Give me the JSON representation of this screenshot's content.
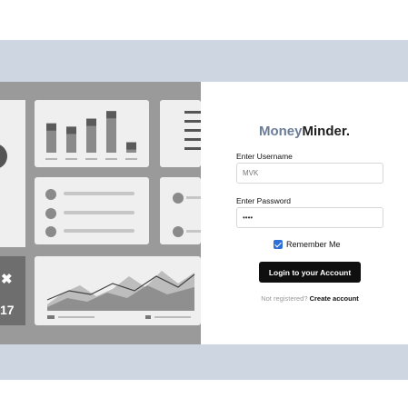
{
  "brand": {
    "part1": "Money",
    "part2": "Minder."
  },
  "username": {
    "label": "Enter Username",
    "value": "MVK"
  },
  "password": {
    "label": "Enter Password",
    "value": "••••"
  },
  "remember": {
    "label": "Remember Me",
    "checked": true
  },
  "login_button": "Login to your Account",
  "register": {
    "prompt": "Not registered?",
    "link": "Create account"
  },
  "illustration": {
    "side_text_1": "✖",
    "side_text_2": "17",
    "bar_values": [
      0.62,
      0.55,
      0.72,
      0.88,
      0.22
    ]
  },
  "colors": {
    "band": "#cdd6e1",
    "brand_accent": "#6b7c99",
    "button": "#0f0f0f",
    "checkbox": "#2e6fd8"
  }
}
